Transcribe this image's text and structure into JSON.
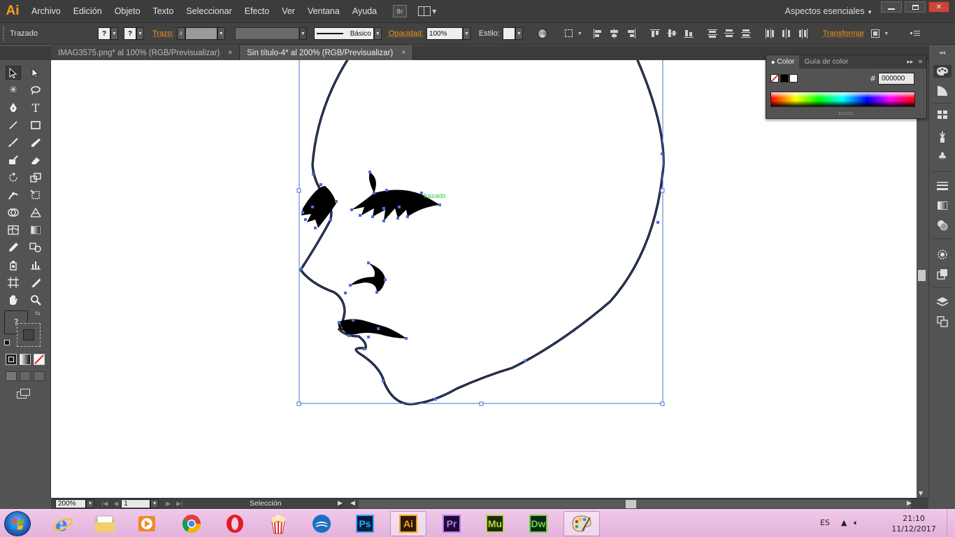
{
  "app": {
    "logo": "Ai",
    "brand_color": "#f7a21b"
  },
  "menubar": {
    "items": [
      "Archivo",
      "Edición",
      "Objeto",
      "Texto",
      "Seleccionar",
      "Efecto",
      "Ver",
      "Ventana",
      "Ayuda"
    ],
    "bridge_label": "Br",
    "workspace": "Aspectos esenciales",
    "window_controls": [
      "minimize-icon",
      "restore-icon",
      "close-icon"
    ]
  },
  "controlbar": {
    "object_type": "Trazado",
    "fill_value": "?",
    "stroke_value": "?",
    "stroke_label": "Trazo:",
    "brush_label": "Básico",
    "opacity_label": "Opacidad:",
    "opacity_value": "100%",
    "style_label": "Estilo:",
    "transform_label": "Transformar"
  },
  "tabs": [
    {
      "label": "IMAG3575.png* al 100% (RGB/Previsualizar)",
      "active": false
    },
    {
      "label": "Sin título-4* al 200% (RGB/Previsualizar)",
      "active": true
    }
  ],
  "tab_close_glyph": "×",
  "canvas": {
    "hover_label": "trazado",
    "hover_color": "#39c639",
    "selection_color": "#4a6fd6"
  },
  "tools": {
    "type_tool_glyph": "T",
    "unknown_fill": "?"
  },
  "colorpanel": {
    "tabs": [
      "Color",
      "Guía de color"
    ],
    "hex_label": "#",
    "hex_value": "000000"
  },
  "statusbar": {
    "zoom": "200%",
    "artboard": "1",
    "tool_status": "Selección"
  },
  "taskbar": {
    "apps": [
      "internet-explorer",
      "file-explorer",
      "media-player",
      "chrome",
      "opera",
      "popcorn-time",
      "thunderbird",
      "photoshop",
      "illustrator",
      "premiere",
      "muse",
      "dreamweaver",
      "paint"
    ],
    "adobe": {
      "ps": "Ps",
      "ai": "Ai",
      "pr": "Pr",
      "mu": "Mu",
      "dw": "Dw"
    },
    "language": "ES",
    "time": "21:10",
    "date": "11/12/2017"
  }
}
